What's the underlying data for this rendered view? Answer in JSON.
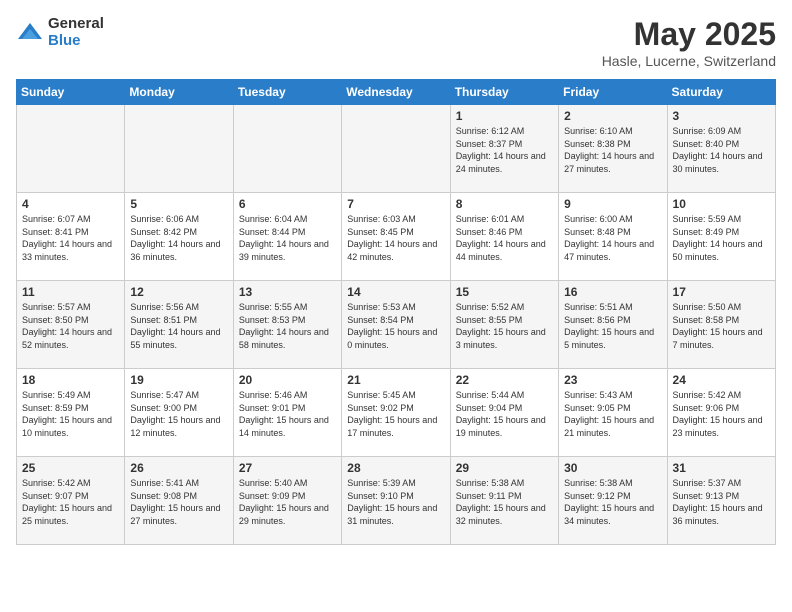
{
  "logo": {
    "general": "General",
    "blue": "Blue"
  },
  "title": "May 2025",
  "location": "Hasle, Lucerne, Switzerland",
  "weekdays": [
    "Sunday",
    "Monday",
    "Tuesday",
    "Wednesday",
    "Thursday",
    "Friday",
    "Saturday"
  ],
  "weeks": [
    [
      {
        "day": "",
        "sunrise": "",
        "sunset": "",
        "daylight": ""
      },
      {
        "day": "",
        "sunrise": "",
        "sunset": "",
        "daylight": ""
      },
      {
        "day": "",
        "sunrise": "",
        "sunset": "",
        "daylight": ""
      },
      {
        "day": "",
        "sunrise": "",
        "sunset": "",
        "daylight": ""
      },
      {
        "day": "1",
        "sunrise": "6:12 AM",
        "sunset": "8:37 PM",
        "daylight": "14 hours and 24 minutes."
      },
      {
        "day": "2",
        "sunrise": "6:10 AM",
        "sunset": "8:38 PM",
        "daylight": "14 hours and 27 minutes."
      },
      {
        "day": "3",
        "sunrise": "6:09 AM",
        "sunset": "8:40 PM",
        "daylight": "14 hours and 30 minutes."
      }
    ],
    [
      {
        "day": "4",
        "sunrise": "6:07 AM",
        "sunset": "8:41 PM",
        "daylight": "14 hours and 33 minutes."
      },
      {
        "day": "5",
        "sunrise": "6:06 AM",
        "sunset": "8:42 PM",
        "daylight": "14 hours and 36 minutes."
      },
      {
        "day": "6",
        "sunrise": "6:04 AM",
        "sunset": "8:44 PM",
        "daylight": "14 hours and 39 minutes."
      },
      {
        "day": "7",
        "sunrise": "6:03 AM",
        "sunset": "8:45 PM",
        "daylight": "14 hours and 42 minutes."
      },
      {
        "day": "8",
        "sunrise": "6:01 AM",
        "sunset": "8:46 PM",
        "daylight": "14 hours and 44 minutes."
      },
      {
        "day": "9",
        "sunrise": "6:00 AM",
        "sunset": "8:48 PM",
        "daylight": "14 hours and 47 minutes."
      },
      {
        "day": "10",
        "sunrise": "5:59 AM",
        "sunset": "8:49 PM",
        "daylight": "14 hours and 50 minutes."
      }
    ],
    [
      {
        "day": "11",
        "sunrise": "5:57 AM",
        "sunset": "8:50 PM",
        "daylight": "14 hours and 52 minutes."
      },
      {
        "day": "12",
        "sunrise": "5:56 AM",
        "sunset": "8:51 PM",
        "daylight": "14 hours and 55 minutes."
      },
      {
        "day": "13",
        "sunrise": "5:55 AM",
        "sunset": "8:53 PM",
        "daylight": "14 hours and 58 minutes."
      },
      {
        "day": "14",
        "sunrise": "5:53 AM",
        "sunset": "8:54 PM",
        "daylight": "15 hours and 0 minutes."
      },
      {
        "day": "15",
        "sunrise": "5:52 AM",
        "sunset": "8:55 PM",
        "daylight": "15 hours and 3 minutes."
      },
      {
        "day": "16",
        "sunrise": "5:51 AM",
        "sunset": "8:56 PM",
        "daylight": "15 hours and 5 minutes."
      },
      {
        "day": "17",
        "sunrise": "5:50 AM",
        "sunset": "8:58 PM",
        "daylight": "15 hours and 7 minutes."
      }
    ],
    [
      {
        "day": "18",
        "sunrise": "5:49 AM",
        "sunset": "8:59 PM",
        "daylight": "15 hours and 10 minutes."
      },
      {
        "day": "19",
        "sunrise": "5:47 AM",
        "sunset": "9:00 PM",
        "daylight": "15 hours and 12 minutes."
      },
      {
        "day": "20",
        "sunrise": "5:46 AM",
        "sunset": "9:01 PM",
        "daylight": "15 hours and 14 minutes."
      },
      {
        "day": "21",
        "sunrise": "5:45 AM",
        "sunset": "9:02 PM",
        "daylight": "15 hours and 17 minutes."
      },
      {
        "day": "22",
        "sunrise": "5:44 AM",
        "sunset": "9:04 PM",
        "daylight": "15 hours and 19 minutes."
      },
      {
        "day": "23",
        "sunrise": "5:43 AM",
        "sunset": "9:05 PM",
        "daylight": "15 hours and 21 minutes."
      },
      {
        "day": "24",
        "sunrise": "5:42 AM",
        "sunset": "9:06 PM",
        "daylight": "15 hours and 23 minutes."
      }
    ],
    [
      {
        "day": "25",
        "sunrise": "5:42 AM",
        "sunset": "9:07 PM",
        "daylight": "15 hours and 25 minutes."
      },
      {
        "day": "26",
        "sunrise": "5:41 AM",
        "sunset": "9:08 PM",
        "daylight": "15 hours and 27 minutes."
      },
      {
        "day": "27",
        "sunrise": "5:40 AM",
        "sunset": "9:09 PM",
        "daylight": "15 hours and 29 minutes."
      },
      {
        "day": "28",
        "sunrise": "5:39 AM",
        "sunset": "9:10 PM",
        "daylight": "15 hours and 31 minutes."
      },
      {
        "day": "29",
        "sunrise": "5:38 AM",
        "sunset": "9:11 PM",
        "daylight": "15 hours and 32 minutes."
      },
      {
        "day": "30",
        "sunrise": "5:38 AM",
        "sunset": "9:12 PM",
        "daylight": "15 hours and 34 minutes."
      },
      {
        "day": "31",
        "sunrise": "5:37 AM",
        "sunset": "9:13 PM",
        "daylight": "15 hours and 36 minutes."
      }
    ]
  ],
  "labels": {
    "sunrise": "Sunrise:",
    "sunset": "Sunset:",
    "daylight": "Daylight:"
  }
}
